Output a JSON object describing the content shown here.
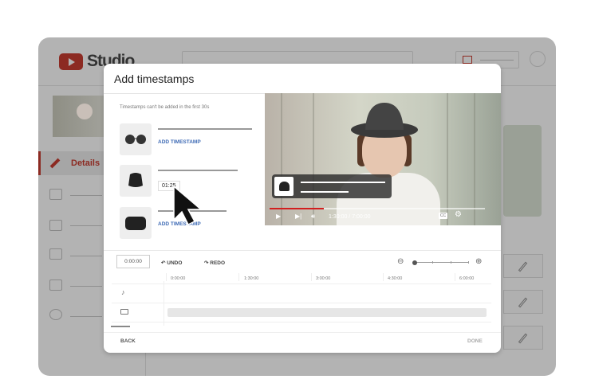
{
  "studio": {
    "logo_text": "Studio",
    "nav_active": "Details"
  },
  "modal": {
    "title": "Add timestamps",
    "note": "Timestamps can't be added in the first 30s",
    "items": [
      {
        "product": "sunglasses",
        "action": "ADD TIMESTAMP"
      },
      {
        "product": "bucket-hat",
        "timestamp": "01:25"
      },
      {
        "product": "belt-bag",
        "action": "ADD TIMESTAMP"
      }
    ],
    "player": {
      "timecode": "1:30:00 / 7:00:00",
      "progress": 0.25,
      "cc": "CC"
    },
    "toolbar": {
      "time_input": "0:00:00",
      "undo": "UNDO",
      "redo": "REDO"
    },
    "ruler": [
      "0:00:00",
      "1:30:00",
      "3:00:00",
      "4:30:00",
      "6:00:00"
    ],
    "footer": {
      "back": "BACK",
      "done": "DONE"
    }
  },
  "colors": {
    "accent": "#3f6bb5",
    "progress": "#d21f1f",
    "brand": "#8c2a22"
  }
}
